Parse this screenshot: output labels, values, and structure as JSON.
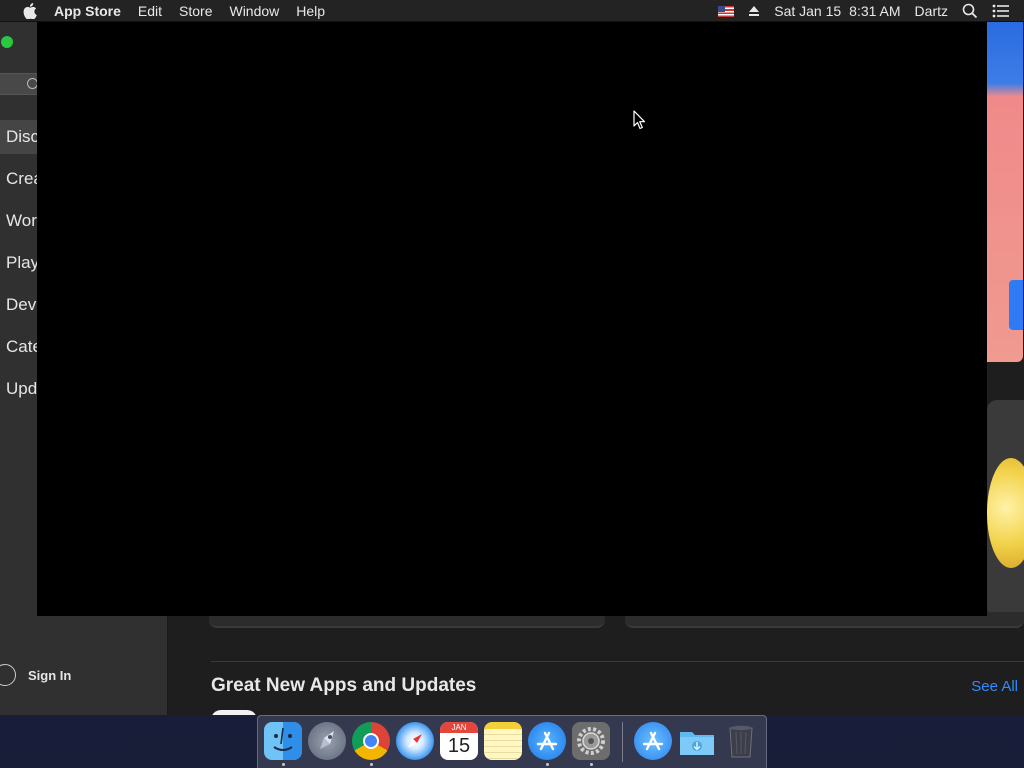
{
  "menubar": {
    "app_name": "App Store",
    "menus": [
      "Edit",
      "Store",
      "Window",
      "Help"
    ],
    "date": "Sat Jan 15",
    "time": "8:31 AM",
    "user": "Dartz"
  },
  "sidebar": {
    "items": [
      {
        "label": "Disc",
        "selected": true
      },
      {
        "label": "Crea",
        "selected": false
      },
      {
        "label": "Wor",
        "selected": false
      },
      {
        "label": "Play",
        "selected": false
      },
      {
        "label": "Dev",
        "selected": false
      },
      {
        "label": "Cate",
        "selected": false
      },
      {
        "label": "Upd",
        "selected": false
      }
    ],
    "sign_in": "Sign In"
  },
  "main": {
    "section_title": "Great New Apps and Updates",
    "see_all": "See All"
  },
  "dock": {
    "calendar_month": "JAN",
    "calendar_day": "15",
    "apps": [
      "Finder",
      "Launchpad",
      "Google Chrome",
      "Safari",
      "Calendar",
      "Notes",
      "App Store",
      "System Preferences",
      "App Store",
      "Downloads",
      "Trash"
    ]
  },
  "colors": {
    "accent": "#2f8cff",
    "menubar": "#232323",
    "sidebar": "#303030",
    "overlay": "#000000"
  }
}
